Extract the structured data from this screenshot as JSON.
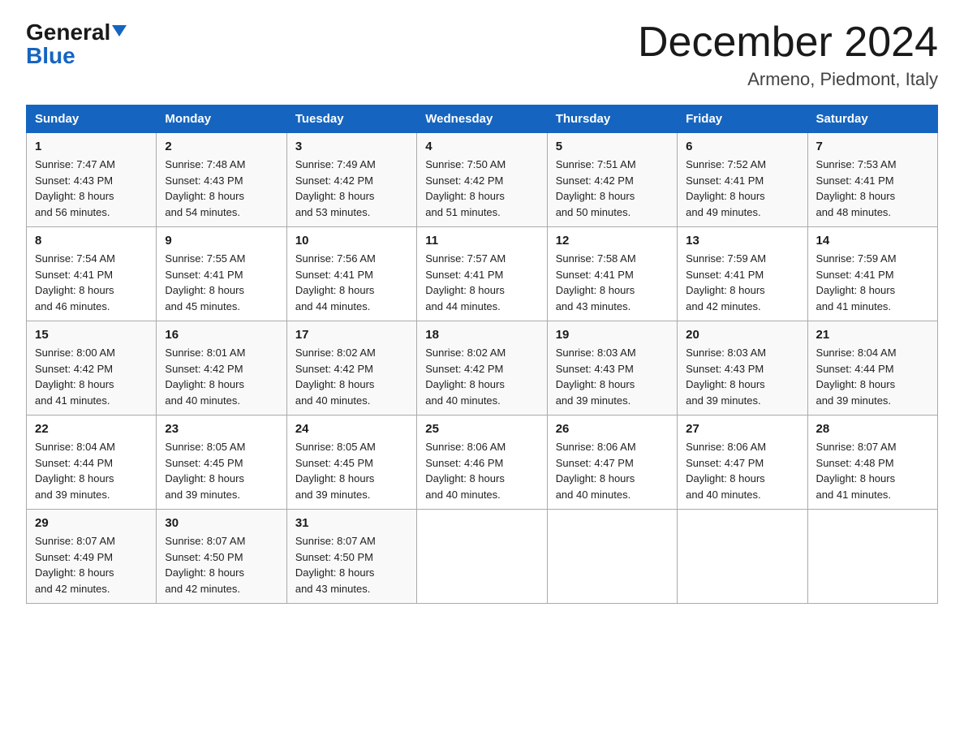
{
  "header": {
    "logo_general": "General",
    "logo_blue": "Blue",
    "month_year": "December 2024",
    "location": "Armeno, Piedmont, Italy"
  },
  "days_of_week": [
    "Sunday",
    "Monday",
    "Tuesday",
    "Wednesday",
    "Thursday",
    "Friday",
    "Saturday"
  ],
  "weeks": [
    [
      {
        "day": "1",
        "sunrise": "7:47 AM",
        "sunset": "4:43 PM",
        "daylight": "8 hours and 56 minutes."
      },
      {
        "day": "2",
        "sunrise": "7:48 AM",
        "sunset": "4:43 PM",
        "daylight": "8 hours and 54 minutes."
      },
      {
        "day": "3",
        "sunrise": "7:49 AM",
        "sunset": "4:42 PM",
        "daylight": "8 hours and 53 minutes."
      },
      {
        "day": "4",
        "sunrise": "7:50 AM",
        "sunset": "4:42 PM",
        "daylight": "8 hours and 51 minutes."
      },
      {
        "day": "5",
        "sunrise": "7:51 AM",
        "sunset": "4:42 PM",
        "daylight": "8 hours and 50 minutes."
      },
      {
        "day": "6",
        "sunrise": "7:52 AM",
        "sunset": "4:41 PM",
        "daylight": "8 hours and 49 minutes."
      },
      {
        "day": "7",
        "sunrise": "7:53 AM",
        "sunset": "4:41 PM",
        "daylight": "8 hours and 48 minutes."
      }
    ],
    [
      {
        "day": "8",
        "sunrise": "7:54 AM",
        "sunset": "4:41 PM",
        "daylight": "8 hours and 46 minutes."
      },
      {
        "day": "9",
        "sunrise": "7:55 AM",
        "sunset": "4:41 PM",
        "daylight": "8 hours and 45 minutes."
      },
      {
        "day": "10",
        "sunrise": "7:56 AM",
        "sunset": "4:41 PM",
        "daylight": "8 hours and 44 minutes."
      },
      {
        "day": "11",
        "sunrise": "7:57 AM",
        "sunset": "4:41 PM",
        "daylight": "8 hours and 44 minutes."
      },
      {
        "day": "12",
        "sunrise": "7:58 AM",
        "sunset": "4:41 PM",
        "daylight": "8 hours and 43 minutes."
      },
      {
        "day": "13",
        "sunrise": "7:59 AM",
        "sunset": "4:41 PM",
        "daylight": "8 hours and 42 minutes."
      },
      {
        "day": "14",
        "sunrise": "7:59 AM",
        "sunset": "4:41 PM",
        "daylight": "8 hours and 41 minutes."
      }
    ],
    [
      {
        "day": "15",
        "sunrise": "8:00 AM",
        "sunset": "4:42 PM",
        "daylight": "8 hours and 41 minutes."
      },
      {
        "day": "16",
        "sunrise": "8:01 AM",
        "sunset": "4:42 PM",
        "daylight": "8 hours and 40 minutes."
      },
      {
        "day": "17",
        "sunrise": "8:02 AM",
        "sunset": "4:42 PM",
        "daylight": "8 hours and 40 minutes."
      },
      {
        "day": "18",
        "sunrise": "8:02 AM",
        "sunset": "4:42 PM",
        "daylight": "8 hours and 40 minutes."
      },
      {
        "day": "19",
        "sunrise": "8:03 AM",
        "sunset": "4:43 PM",
        "daylight": "8 hours and 39 minutes."
      },
      {
        "day": "20",
        "sunrise": "8:03 AM",
        "sunset": "4:43 PM",
        "daylight": "8 hours and 39 minutes."
      },
      {
        "day": "21",
        "sunrise": "8:04 AM",
        "sunset": "4:44 PM",
        "daylight": "8 hours and 39 minutes."
      }
    ],
    [
      {
        "day": "22",
        "sunrise": "8:04 AM",
        "sunset": "4:44 PM",
        "daylight": "8 hours and 39 minutes."
      },
      {
        "day": "23",
        "sunrise": "8:05 AM",
        "sunset": "4:45 PM",
        "daylight": "8 hours and 39 minutes."
      },
      {
        "day": "24",
        "sunrise": "8:05 AM",
        "sunset": "4:45 PM",
        "daylight": "8 hours and 39 minutes."
      },
      {
        "day": "25",
        "sunrise": "8:06 AM",
        "sunset": "4:46 PM",
        "daylight": "8 hours and 40 minutes."
      },
      {
        "day": "26",
        "sunrise": "8:06 AM",
        "sunset": "4:47 PM",
        "daylight": "8 hours and 40 minutes."
      },
      {
        "day": "27",
        "sunrise": "8:06 AM",
        "sunset": "4:47 PM",
        "daylight": "8 hours and 40 minutes."
      },
      {
        "day": "28",
        "sunrise": "8:07 AM",
        "sunset": "4:48 PM",
        "daylight": "8 hours and 41 minutes."
      }
    ],
    [
      {
        "day": "29",
        "sunrise": "8:07 AM",
        "sunset": "4:49 PM",
        "daylight": "8 hours and 42 minutes."
      },
      {
        "day": "30",
        "sunrise": "8:07 AM",
        "sunset": "4:50 PM",
        "daylight": "8 hours and 42 minutes."
      },
      {
        "day": "31",
        "sunrise": "8:07 AM",
        "sunset": "4:50 PM",
        "daylight": "8 hours and 43 minutes."
      },
      null,
      null,
      null,
      null
    ]
  ],
  "labels": {
    "sunrise": "Sunrise:",
    "sunset": "Sunset:",
    "daylight": "Daylight:"
  }
}
